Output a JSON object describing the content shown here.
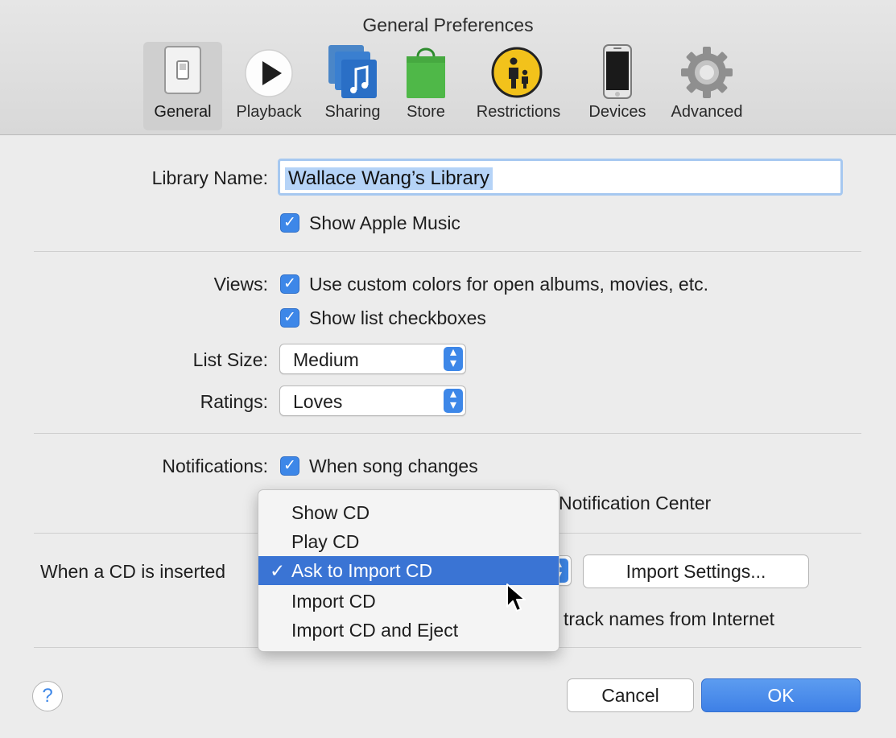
{
  "window": {
    "title": "General Preferences"
  },
  "toolbar": {
    "items": [
      {
        "label": "General",
        "icon": "general-switch-icon",
        "selected": true
      },
      {
        "label": "Playback",
        "icon": "play-icon"
      },
      {
        "label": "Sharing",
        "icon": "sharing-music-icon"
      },
      {
        "label": "Store",
        "icon": "store-bag-icon"
      },
      {
        "label": "Restrictions",
        "icon": "restrictions-parental-icon"
      },
      {
        "label": "Devices",
        "icon": "iphone-device-icon"
      },
      {
        "label": "Advanced",
        "icon": "gear-icon"
      }
    ]
  },
  "library": {
    "label": "Library Name:",
    "value": "Wallace Wang’s Library",
    "show_apple_music": {
      "label": "Show Apple Music",
      "checked": true
    }
  },
  "views": {
    "label": "Views:",
    "custom_colors": {
      "label": "Use custom colors for open albums, movies, etc.",
      "checked": true
    },
    "list_checkboxes": {
      "label": "Show list checkboxes",
      "checked": true
    }
  },
  "list_size": {
    "label": "List Size:",
    "value": "Medium"
  },
  "ratings": {
    "label": "Ratings:",
    "value": "Loves"
  },
  "notifications": {
    "label": "Notifications:",
    "song_changes": {
      "label": "When song changes",
      "checked": true
    },
    "notification_center_partial": "Notification Center"
  },
  "cd": {
    "label": "When a CD is inserted",
    "import_settings": "Import Settings...",
    "track_names_partial": "track names from Internet",
    "menu": {
      "items": [
        "Show CD",
        "Play CD",
        "Ask to Import CD",
        "Import CD",
        "Import CD and Eject"
      ],
      "selected_index": 2,
      "check_mark": "✓"
    }
  },
  "buttons": {
    "help": "?",
    "cancel": "Cancel",
    "ok": "OK"
  },
  "colors": {
    "accent": "#3d87e8",
    "menu_highlight": "#3a74d4",
    "store_green": "#4fb848",
    "restrictions_yellow": "#f2c21b"
  }
}
